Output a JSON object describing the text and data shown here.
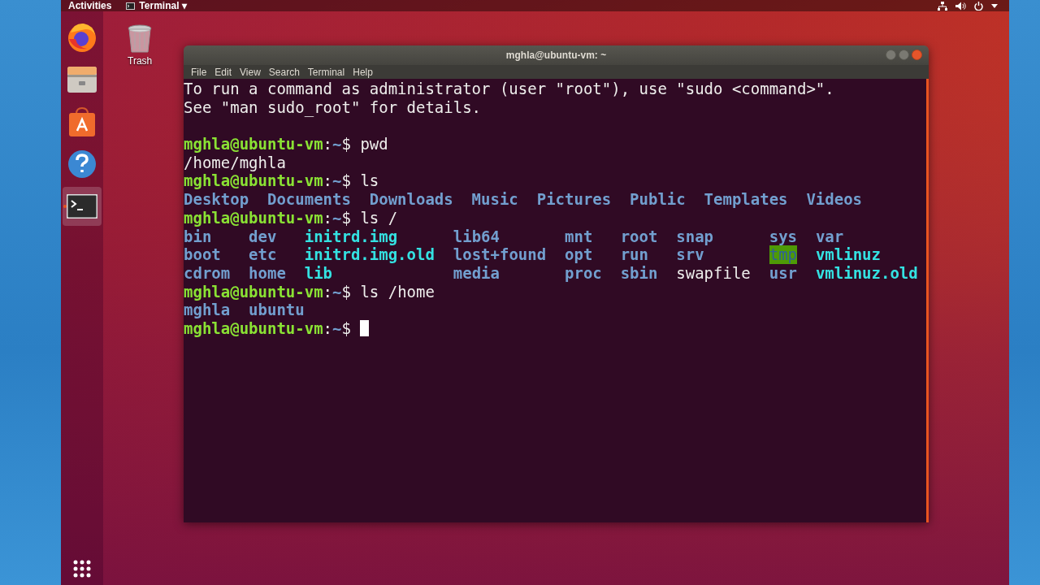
{
  "top_bar": {
    "activities": "Activities",
    "app_menu": "Terminal ▾"
  },
  "dock": {
    "items": [
      {
        "kind": "firefox",
        "active": false
      },
      {
        "kind": "files",
        "active": false
      },
      {
        "kind": "software",
        "active": false
      },
      {
        "kind": "help",
        "active": false
      },
      {
        "kind": "terminal",
        "active": true
      }
    ]
  },
  "desktop": {
    "icons": [
      {
        "label": "Trash"
      }
    ]
  },
  "window": {
    "title": "mghla@ubuntu-vm: ~",
    "menu": [
      "File",
      "Edit",
      "View",
      "Search",
      "Terminal",
      "Help"
    ],
    "blocks": [
      {
        "kind": "line",
        "segments": [
          {
            "kind": "text",
            "text": "To run a command as administrator (user \"root\"), use \"sudo <command>\"."
          }
        ]
      },
      {
        "kind": "line",
        "segments": [
          {
            "kind": "text",
            "text": "See \"man sudo_root\" for details."
          }
        ]
      },
      {
        "kind": "blank"
      },
      {
        "kind": "line",
        "segments": [
          {
            "kind": "user",
            "text": "mghla@ubuntu-vm"
          },
          {
            "kind": "text",
            "text": ":"
          },
          {
            "kind": "path",
            "text": "~"
          },
          {
            "kind": "text",
            "text": "$ pwd"
          }
        ]
      },
      {
        "kind": "line",
        "segments": [
          {
            "kind": "text",
            "text": "/home/mghla"
          }
        ]
      },
      {
        "kind": "line",
        "segments": [
          {
            "kind": "user",
            "text": "mghla@ubuntu-vm"
          },
          {
            "kind": "text",
            "text": ":"
          },
          {
            "kind": "path",
            "text": "~"
          },
          {
            "kind": "text",
            "text": "$ ls"
          }
        ]
      },
      {
        "kind": "grid",
        "rows": [
          [
            {
              "kind": "dir",
              "text": "Desktop"
            },
            {
              "kind": "dir",
              "text": "Documents"
            },
            {
              "kind": "dir",
              "text": "Downloads"
            },
            {
              "kind": "dir",
              "text": "Music"
            },
            {
              "kind": "dir",
              "text": "Pictures"
            },
            {
              "kind": "dir",
              "text": "Public"
            },
            {
              "kind": "dir",
              "text": "Templates"
            },
            {
              "kind": "dir",
              "text": "Videos"
            }
          ]
        ]
      },
      {
        "kind": "line",
        "segments": [
          {
            "kind": "user",
            "text": "mghla@ubuntu-vm"
          },
          {
            "kind": "text",
            "text": ":"
          },
          {
            "kind": "path",
            "text": "~"
          },
          {
            "kind": "text",
            "text": "$ ls /"
          }
        ]
      },
      {
        "kind": "grid",
        "rows": [
          [
            {
              "kind": "dir",
              "text": "bin"
            },
            {
              "kind": "dir",
              "text": "dev"
            },
            {
              "kind": "link",
              "text": "initrd.img"
            },
            {
              "kind": "dir",
              "text": "lib64"
            },
            {
              "kind": "dir",
              "text": "mnt"
            },
            {
              "kind": "dir",
              "text": "root"
            },
            {
              "kind": "dir",
              "text": "snap"
            },
            {
              "kind": "dir",
              "text": "sys"
            },
            {
              "kind": "dir",
              "text": "var"
            }
          ],
          [
            {
              "kind": "dir",
              "text": "boot"
            },
            {
              "kind": "dir",
              "text": "etc"
            },
            {
              "kind": "link",
              "text": "initrd.img.old"
            },
            {
              "kind": "dir",
              "text": "lost+found"
            },
            {
              "kind": "dir",
              "text": "opt"
            },
            {
              "kind": "dir",
              "text": "run"
            },
            {
              "kind": "dir",
              "text": "srv"
            },
            {
              "kind": "sticky",
              "text": "tmp"
            },
            {
              "kind": "link",
              "text": "vmlinuz"
            }
          ],
          [
            {
              "kind": "dir",
              "text": "cdrom"
            },
            {
              "kind": "dir",
              "text": "home"
            },
            {
              "kind": "link",
              "text": "lib"
            },
            {
              "kind": "dir",
              "text": "media"
            },
            {
              "kind": "dir",
              "text": "proc"
            },
            {
              "kind": "dir",
              "text": "sbin"
            },
            {
              "kind": "text",
              "text": "swapfile"
            },
            {
              "kind": "dir",
              "text": "usr"
            },
            {
              "kind": "link",
              "text": "vmlinuz.old"
            }
          ]
        ]
      },
      {
        "kind": "line",
        "segments": [
          {
            "kind": "user",
            "text": "mghla@ubuntu-vm"
          },
          {
            "kind": "text",
            "text": ":"
          },
          {
            "kind": "path",
            "text": "~"
          },
          {
            "kind": "text",
            "text": "$ ls /home"
          }
        ]
      },
      {
        "kind": "grid",
        "rows": [
          [
            {
              "kind": "dir",
              "text": "mghla"
            },
            {
              "kind": "dir",
              "text": "ubuntu"
            }
          ]
        ]
      },
      {
        "kind": "line",
        "segments": [
          {
            "kind": "user",
            "text": "mghla@ubuntu-vm"
          },
          {
            "kind": "text",
            "text": ":"
          },
          {
            "kind": "path",
            "text": "~"
          },
          {
            "kind": "text",
            "text": "$ "
          },
          {
            "kind": "cursor"
          }
        ]
      }
    ]
  }
}
